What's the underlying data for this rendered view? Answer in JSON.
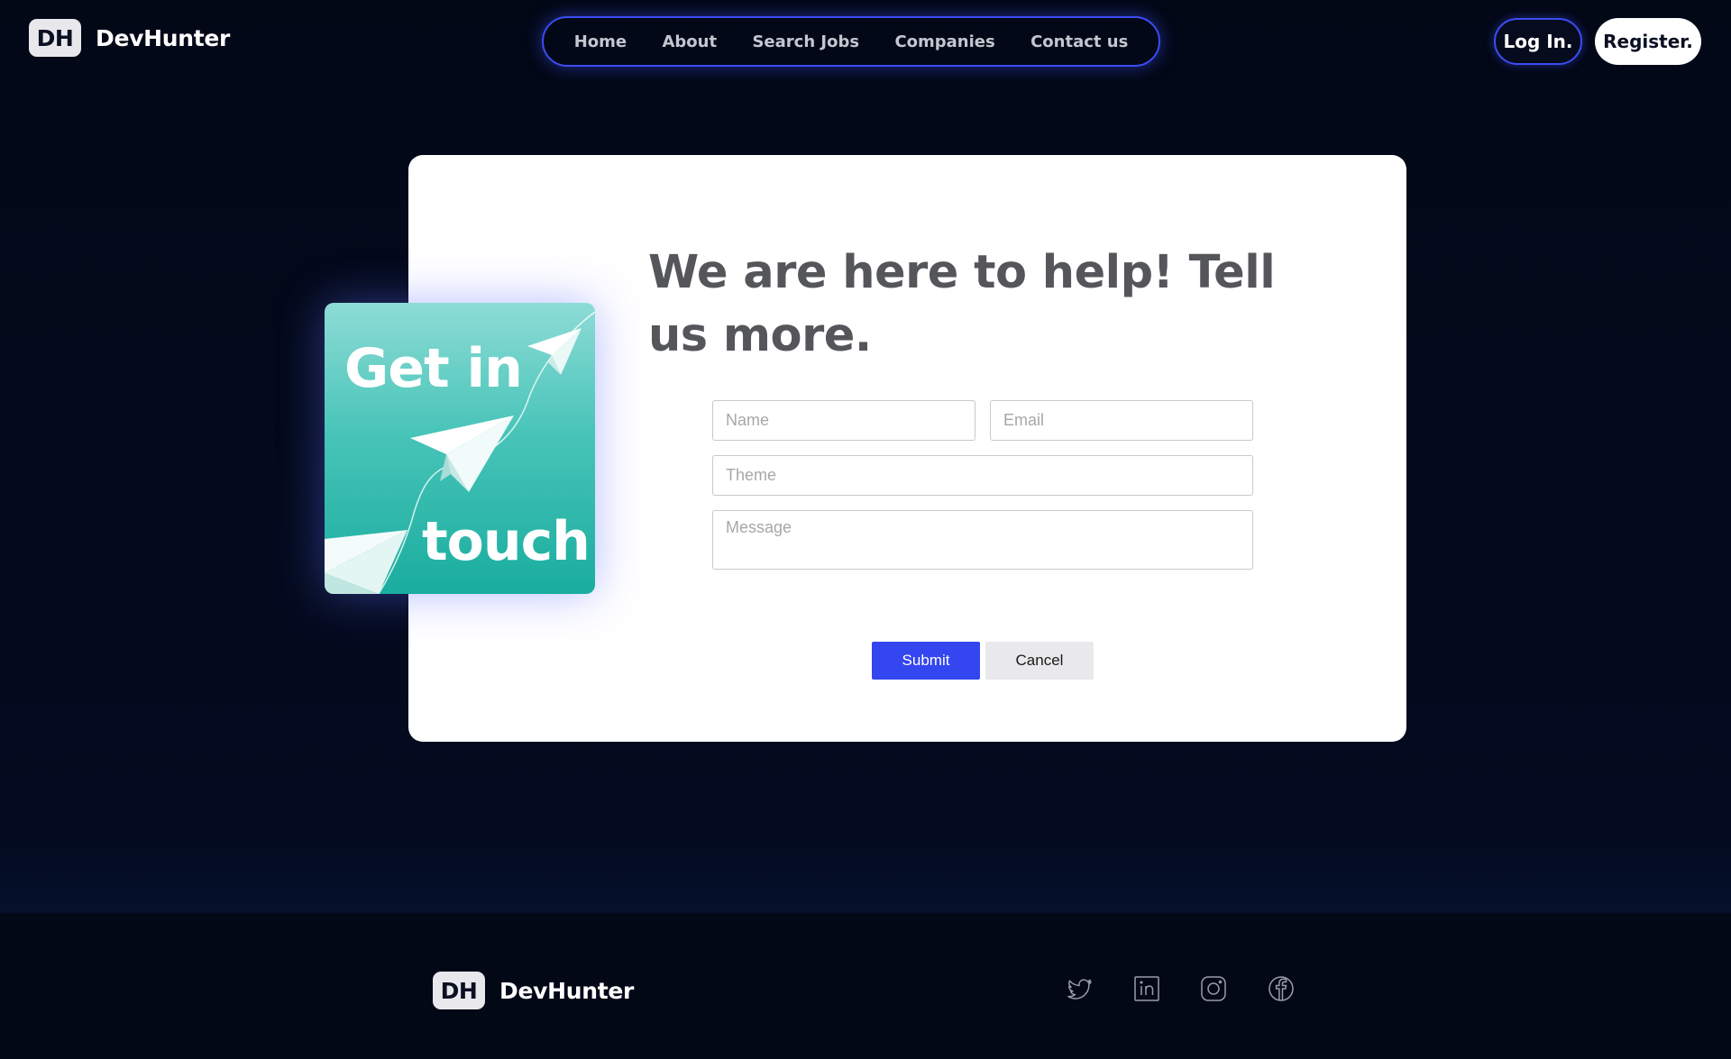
{
  "brand": {
    "badge": "DH",
    "name": "DevHunter"
  },
  "nav": {
    "items": [
      {
        "label": "Home"
      },
      {
        "label": "About"
      },
      {
        "label": "Search Jobs"
      },
      {
        "label": "Companies"
      },
      {
        "label": "Contact us"
      }
    ]
  },
  "auth": {
    "login_label": "Log In.",
    "register_label": "Register."
  },
  "colors": {
    "background": "#030817",
    "accent": "#3b4cf2",
    "submit": "#3446f0",
    "promo_teal": "#19ad9f"
  },
  "contact": {
    "promo": {
      "line1": "Get in",
      "line2": "touch",
      "icons": [
        "paper-plane-icon",
        "paper-plane-icon",
        "paper-plane-icon"
      ]
    },
    "title": "We are here to help! Tell us more.",
    "form": {
      "name_placeholder": "Name",
      "email_placeholder": "Email",
      "theme_placeholder": "Theme",
      "message_placeholder": "Message",
      "submit_label": "Submit",
      "cancel_label": "Cancel"
    }
  },
  "footer": {
    "brand": {
      "badge": "DH",
      "name": "DevHunter"
    },
    "social": [
      "twitter-icon",
      "linkedin-icon",
      "instagram-icon",
      "facebook-icon"
    ]
  }
}
